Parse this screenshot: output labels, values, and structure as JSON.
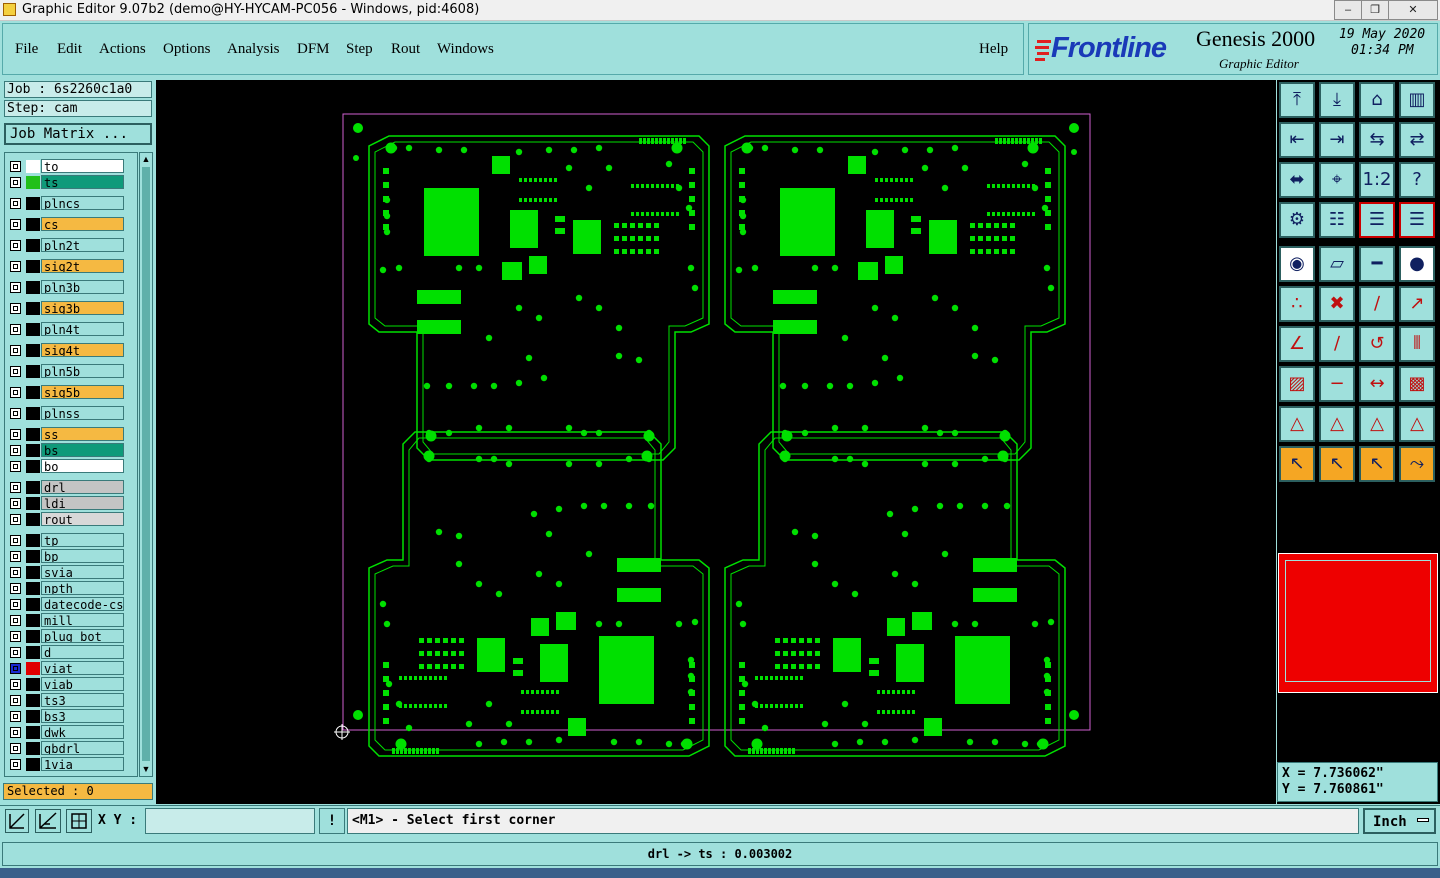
{
  "window": {
    "title": "Graphic Editor 9.07b2 (demo@HY-HYCAM-PC056 - Windows, pid:4608)",
    "controls": [
      "minimize",
      "restore",
      "close"
    ]
  },
  "menu": {
    "items": [
      "File",
      "Edit",
      "Actions",
      "Options",
      "Analysis",
      "DFM",
      "Step",
      "Rout",
      "Windows"
    ],
    "help": "Help"
  },
  "brand": {
    "logo": "Frontline",
    "product": "Genesis 2000",
    "subtitle": "Graphic Editor",
    "date": "19 May 2020",
    "time": "01:34 PM"
  },
  "job": {
    "job_label": "Job : 6s2260c1a0",
    "step_label": "Step: cam",
    "matrix_button": "Job Matrix ..."
  },
  "layers": [
    {
      "name": "to",
      "color": "#ffffff",
      "swatch": "#ffffff"
    },
    {
      "name": "ts",
      "color": "#0f9a7a",
      "swatch": "#22c01a"
    },
    {
      "name": "plncs",
      "color": "#9fe0dc",
      "swatch": ""
    },
    {
      "name": "cs",
      "color": "#f5b942",
      "swatch": ""
    },
    {
      "name": "pln2t",
      "color": "#9fe0dc",
      "swatch": ""
    },
    {
      "name": "sig2t",
      "color": "#f5b942",
      "swatch": ""
    },
    {
      "name": "pln3b",
      "color": "#9fe0dc",
      "swatch": ""
    },
    {
      "name": "sig3b",
      "color": "#f5b942",
      "swatch": ""
    },
    {
      "name": "pln4t",
      "color": "#9fe0dc",
      "swatch": ""
    },
    {
      "name": "sig4t",
      "color": "#f5b942",
      "swatch": ""
    },
    {
      "name": "pln5b",
      "color": "#9fe0dc",
      "swatch": ""
    },
    {
      "name": "sig5b",
      "color": "#f5b942",
      "swatch": ""
    },
    {
      "name": "plnss",
      "color": "#9fe0dc",
      "swatch": ""
    },
    {
      "name": "ss",
      "color": "#f5b942",
      "swatch": ""
    },
    {
      "name": "bs",
      "color": "#0f9a7a",
      "swatch": ""
    },
    {
      "name": "bo",
      "color": "#ffffff",
      "swatch": ""
    },
    {
      "name": "drl",
      "color": "#c4c4c4",
      "swatch": ""
    },
    {
      "name": "ldi",
      "color": "#c4c4c4",
      "swatch": ""
    },
    {
      "name": "rout",
      "color": "#d8d8d8",
      "swatch": ""
    },
    {
      "name": "tp",
      "color": "#9fe0dc",
      "swatch": ""
    },
    {
      "name": "bp",
      "color": "#9fe0dc",
      "swatch": ""
    },
    {
      "name": "svia",
      "color": "#9fe0dc",
      "swatch": ""
    },
    {
      "name": "npth",
      "color": "#9fe0dc",
      "swatch": ""
    },
    {
      "name": "datecode-cs",
      "color": "#9fe0dc",
      "swatch": ""
    },
    {
      "name": "mill",
      "color": "#9fe0dc",
      "swatch": ""
    },
    {
      "name": "plug_bot",
      "color": "#9fe0dc",
      "swatch": ""
    },
    {
      "name": "d",
      "color": "#9fe0dc",
      "swatch": ""
    },
    {
      "name": "viat",
      "color": "#9fe0dc",
      "swatch": "#e00000"
    },
    {
      "name": "viab",
      "color": "#9fe0dc",
      "swatch": ""
    },
    {
      "name": "ts3",
      "color": "#9fe0dc",
      "swatch": ""
    },
    {
      "name": "bs3",
      "color": "#9fe0dc",
      "swatch": ""
    },
    {
      "name": "dwk",
      "color": "#9fe0dc",
      "swatch": ""
    },
    {
      "name": "gbdrl",
      "color": "#9fe0dc",
      "swatch": ""
    },
    {
      "name": "1via",
      "color": "#9fe0dc",
      "swatch": ""
    }
  ],
  "selected_label": "Selected : 0",
  "coords": {
    "x": "X = 7.736062\"",
    "y": "Y = 7.760861\""
  },
  "status": {
    "xy_label": "X Y :",
    "xy_value": "",
    "exclaim": "!",
    "prompt": "<M1> - Select first corner",
    "units": "Inch",
    "bottom_message": "drl -> ts : 0.003002"
  },
  "colors": {
    "pcb_green": "#00e000",
    "profile": "#d060d0",
    "preview_red": "#ee0000"
  }
}
